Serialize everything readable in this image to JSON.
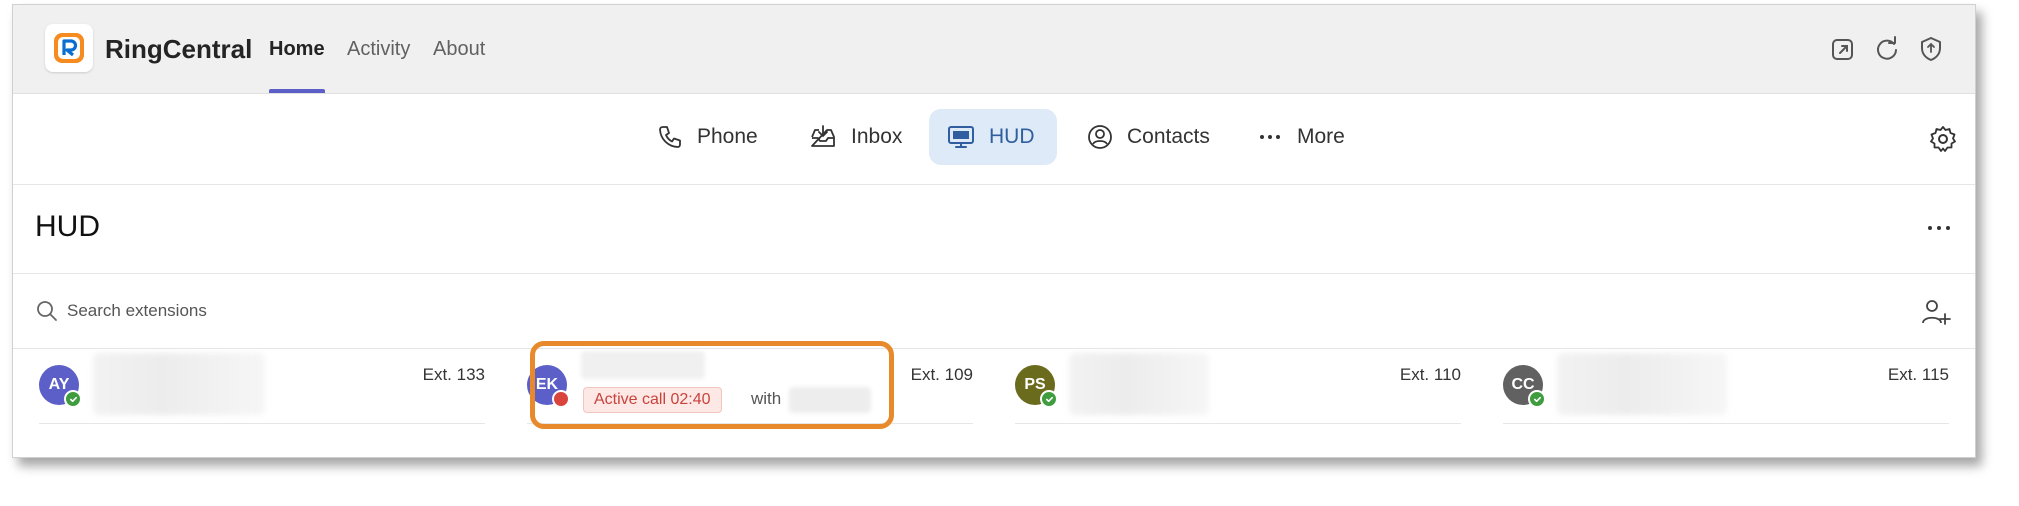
{
  "header": {
    "app_name": "RingCentral",
    "tabs": [
      {
        "label": "Home",
        "active": true
      },
      {
        "label": "Activity",
        "active": false
      },
      {
        "label": "About",
        "active": false
      }
    ],
    "icons": [
      "popout-icon",
      "refresh-icon",
      "shield-icon"
    ]
  },
  "nav": {
    "items": [
      {
        "label": "Phone",
        "icon": "phone-icon",
        "active": false
      },
      {
        "label": "Inbox",
        "icon": "inbox-icon",
        "active": false
      },
      {
        "label": "HUD",
        "icon": "monitor-icon",
        "active": true
      },
      {
        "label": "Contacts",
        "icon": "contact-icon",
        "active": false
      },
      {
        "label": "More",
        "icon": "ellipsis-icon",
        "active": false
      }
    ]
  },
  "hud": {
    "title": "HUD",
    "search_placeholder": "Search extensions"
  },
  "extensions": [
    {
      "initials": "AY",
      "ext": "Ext. 133",
      "avatar_color": "#5b5fc7",
      "presence": "available"
    },
    {
      "initials": "EK",
      "ext": "Ext. 109",
      "avatar_color": "#5b5fc7",
      "presence": "busy",
      "status": "Active call 02:40",
      "with_label": "with"
    },
    {
      "initials": "PS",
      "ext": "Ext. 110",
      "avatar_color": "#6b6b1e",
      "presence": "available"
    },
    {
      "initials": "CC",
      "ext": "Ext. 115",
      "avatar_color": "#616161",
      "presence": "available"
    }
  ],
  "colors": {
    "accent": "#5b5fc7",
    "highlight": "#e8892c",
    "available": "#3f9d3f",
    "busy": "#d9443d"
  }
}
